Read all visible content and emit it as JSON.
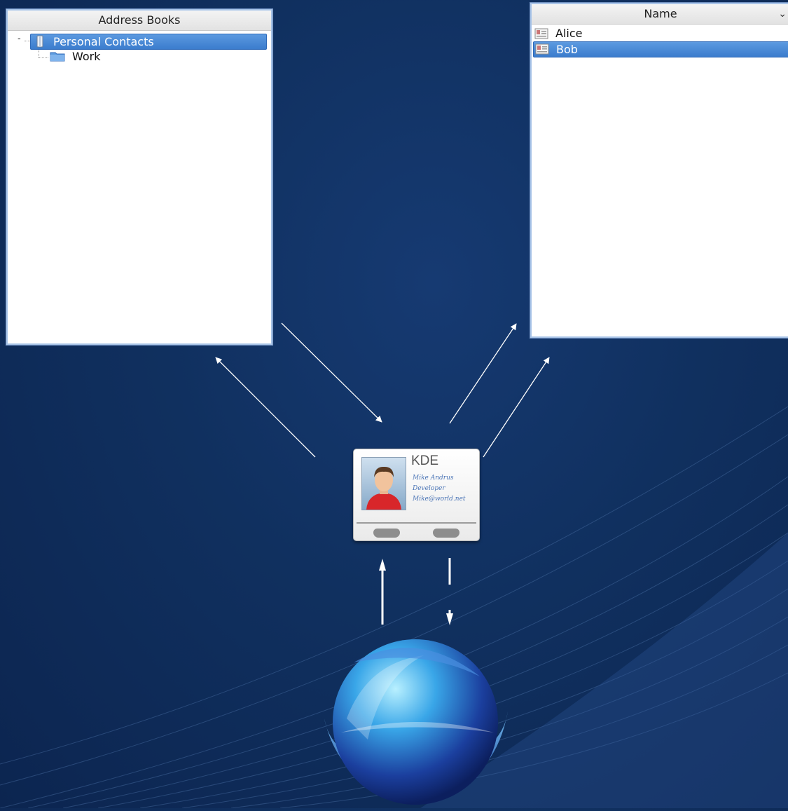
{
  "address_books_panel": {
    "header": "Address Books",
    "items": [
      {
        "label": "Personal Contacts",
        "expander": "-",
        "selected": true,
        "icon": "address-book-icon"
      },
      {
        "label": "Work",
        "selected": false,
        "icon": "folder-icon"
      }
    ]
  },
  "contacts_panel": {
    "header": "Name",
    "chevron_icon": "chevron-down-icon",
    "items": [
      {
        "label": "Alice",
        "selected": false,
        "icon": "vcard-icon"
      },
      {
        "label": "Bob",
        "selected": true,
        "icon": "vcard-icon"
      }
    ]
  },
  "card": {
    "title": "KDE",
    "lines": [
      "Mike Andrus",
      "Developer",
      "Mike@world.net"
    ]
  },
  "colors": {
    "background": "#10305f",
    "selection": "#3b7ccd",
    "arrow": "#ffffff"
  }
}
